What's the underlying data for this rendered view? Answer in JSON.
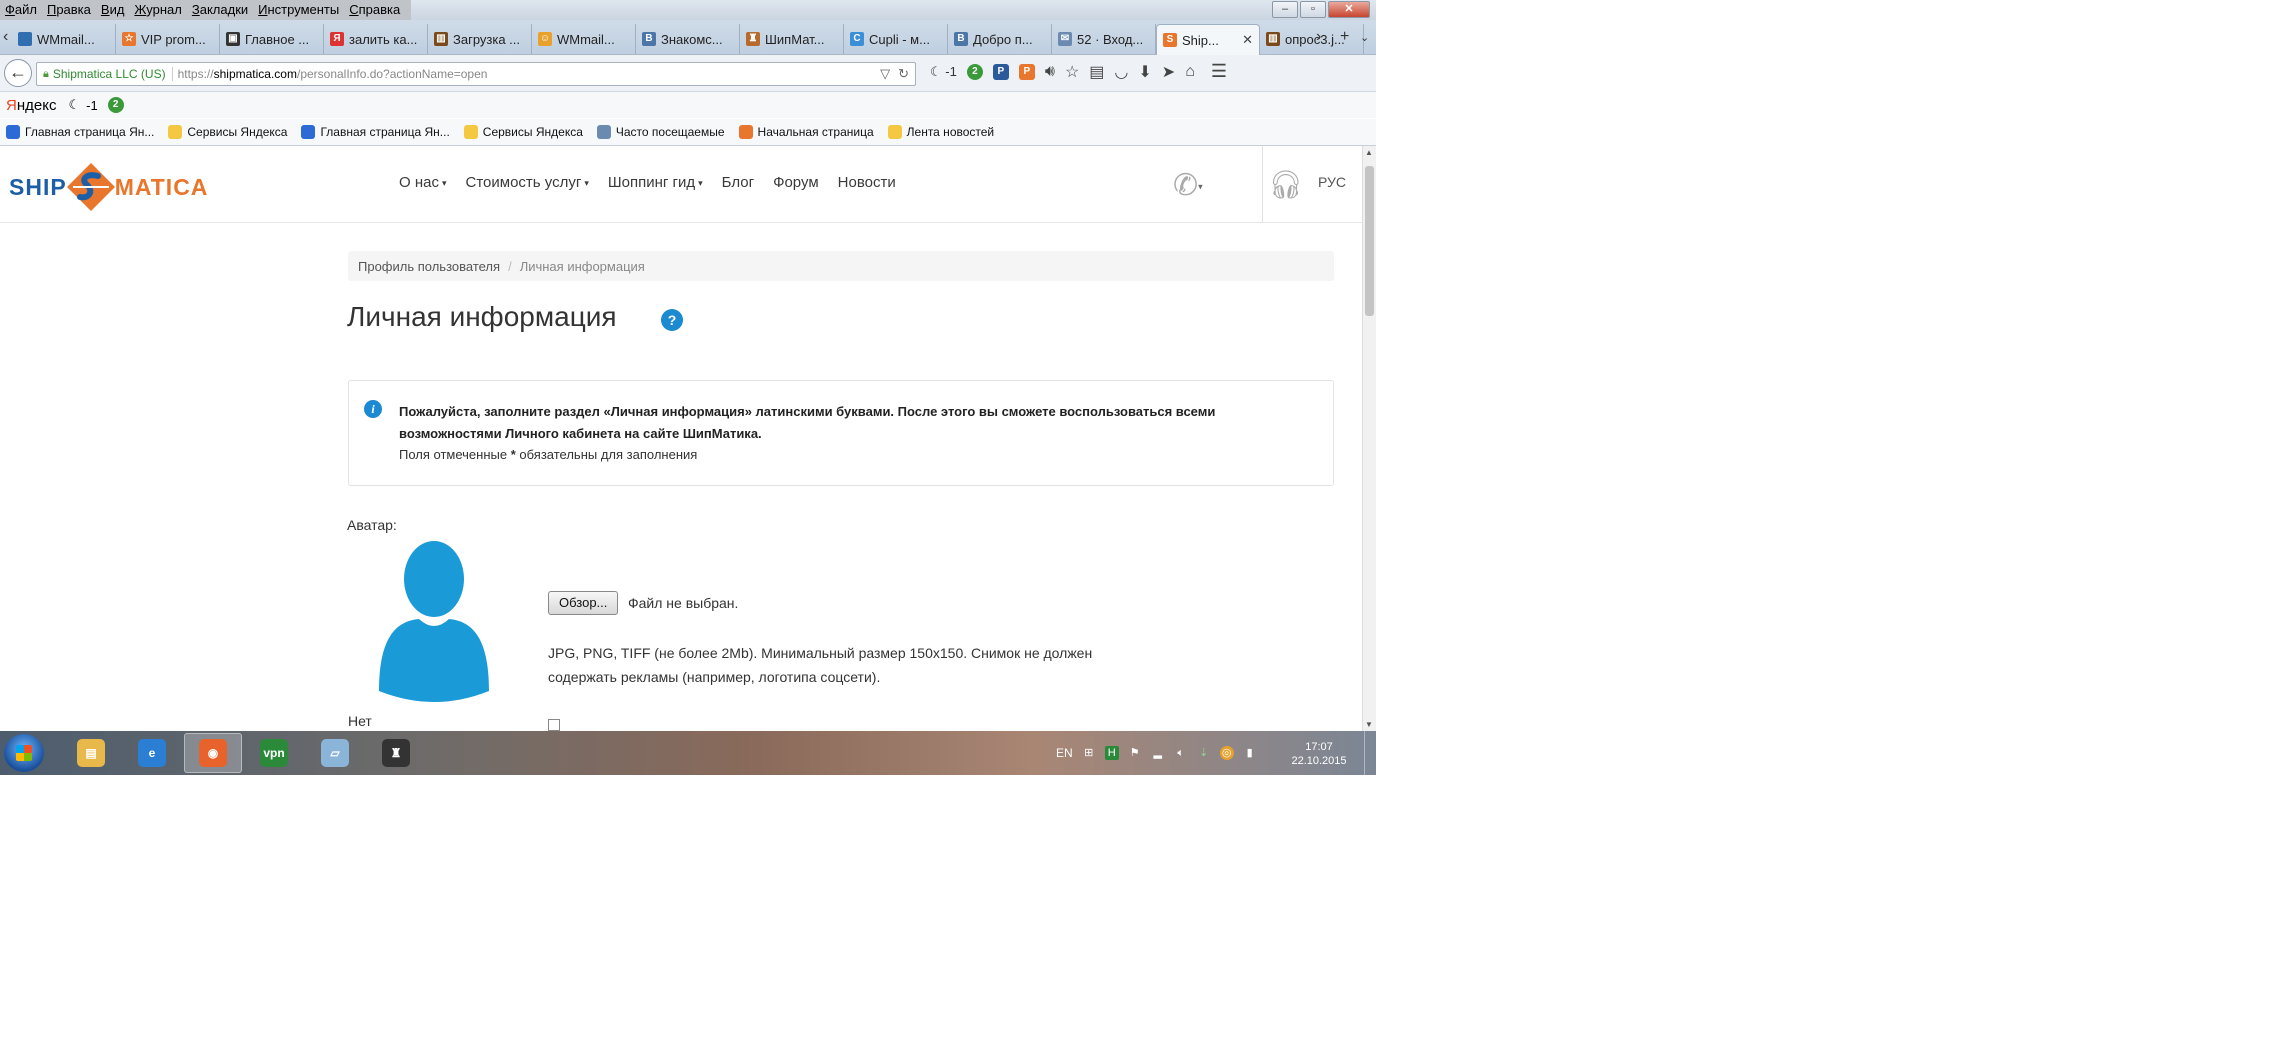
{
  "menu": [
    "Файл",
    "Правка",
    "Вид",
    "Журнал",
    "Закладки",
    "Инструменты",
    "Справка"
  ],
  "tabs": [
    {
      "label": "WMmail...",
      "color": "#2f6fb0",
      "glyph": ""
    },
    {
      "label": "VIP prom...",
      "color": "#e8762c",
      "glyph": "☆"
    },
    {
      "label": "Главное ...",
      "color": "#333333",
      "glyph": "▣"
    },
    {
      "label": "залить ка...",
      "color": "#d33",
      "glyph": "Я"
    },
    {
      "label": "Загрузка ...",
      "color": "#7a4a1a",
      "glyph": "▥"
    },
    {
      "label": "WMmail...",
      "color": "#e8a12c",
      "glyph": "☺"
    },
    {
      "label": "Знакомс...",
      "color": "#4a76a8",
      "glyph": "В"
    },
    {
      "label": "ШипМат...",
      "color": "#b86a2c",
      "glyph": "♜"
    },
    {
      "label": "Cupli - м...",
      "color": "#3a8fd6",
      "glyph": "C"
    },
    {
      "label": "Добро п...",
      "color": "#4a76a8",
      "glyph": "В"
    },
    {
      "label": "52 · Вход...",
      "color": "#6a8ab0",
      "glyph": "✉"
    },
    {
      "label": "Ship...",
      "color": "#e8762c",
      "glyph": "S",
      "active": true
    },
    {
      "label": "опрос3.j...",
      "color": "#7a4a1a",
      "glyph": "▥"
    }
  ],
  "nav": {
    "identity": "Shipmatica LLC (US)",
    "url_prefix": "https://",
    "url_domain": "shipmatica.com",
    "url_path": "/personalInfo.do?actionName=open",
    "weather": "-1"
  },
  "yabar": {
    "logo_first": "Я",
    "logo_rest": "ндекс",
    "weather": "-1"
  },
  "bookmarks": [
    {
      "label": "Главная страница Ян...",
      "color": "#2c6ad6"
    },
    {
      "label": "Сервисы Яндекса",
      "color": "#f5c842"
    },
    {
      "label": "Главная страница Ян...",
      "color": "#2c6ad6"
    },
    {
      "label": "Сервисы Яндекса",
      "color": "#f5c842"
    },
    {
      "label": "Часто посещаемые",
      "color": "#6a8ab0"
    },
    {
      "label": "Начальная страница",
      "color": "#e8762c"
    },
    {
      "label": "Лента новостей",
      "color": "#f5c842"
    }
  ],
  "site": {
    "logo_left": "SHIP",
    "logo_right": "MATICA",
    "nav": [
      {
        "label": "О нас",
        "dropdown": true
      },
      {
        "label": "Стоимость услуг",
        "dropdown": true
      },
      {
        "label": "Шоппинг гид",
        "dropdown": true
      },
      {
        "label": "Блог",
        "dropdown": false
      },
      {
        "label": "Форум",
        "dropdown": false
      },
      {
        "label": "Новости",
        "dropdown": false
      }
    ],
    "lang": "РУС"
  },
  "breadcrumb": {
    "item1": "Профиль пользователя",
    "separator": "/",
    "item2": "Личная информация"
  },
  "page_title": "Личная информация",
  "help_glyph": "?",
  "info": {
    "text": "Пожалуйста, заполните раздел «Личная информация» латинскими буквами. После этого вы сможете воспользоваться всеми возможностями Личного кабинета на сайте ШипМатика.",
    "note_prefix": "Поля отмеченные ",
    "note_star": "*",
    "note_suffix": " обязательны для заполнения"
  },
  "avatar": {
    "label": "Аватар:",
    "browse_label": "Обзор...",
    "no_file": "Файл не выбран.",
    "hint": "JPG, PNG, TIFF (не более 2Mb). Минимальный размер 150x150. Снимок не должен содержать рекламы (например, логотипа соцсети)."
  },
  "no_label": "Нет",
  "taskbar": {
    "apps": [
      {
        "name": "explorer",
        "color": "#e8b84a",
        "glyph": "▤"
      },
      {
        "name": "ie",
        "color": "#2a7fd4",
        "glyph": "e"
      },
      {
        "name": "firefox",
        "color": "#e8622c",
        "glyph": "◉",
        "active": true
      },
      {
        "name": "vpn",
        "color": "#2a8a3a",
        "glyph": "vpn"
      },
      {
        "name": "notepad",
        "color": "#8ab4d8",
        "glyph": "▱"
      },
      {
        "name": "tanks",
        "color": "#333333",
        "glyph": "♜"
      }
    ],
    "lang": "EN",
    "time": "17:07",
    "date": "22.10.2015"
  },
  "colors": {
    "brand_blue": "#1d5fa6",
    "brand_orange": "#e8762c",
    "info_blue": "#1b8ad3"
  }
}
